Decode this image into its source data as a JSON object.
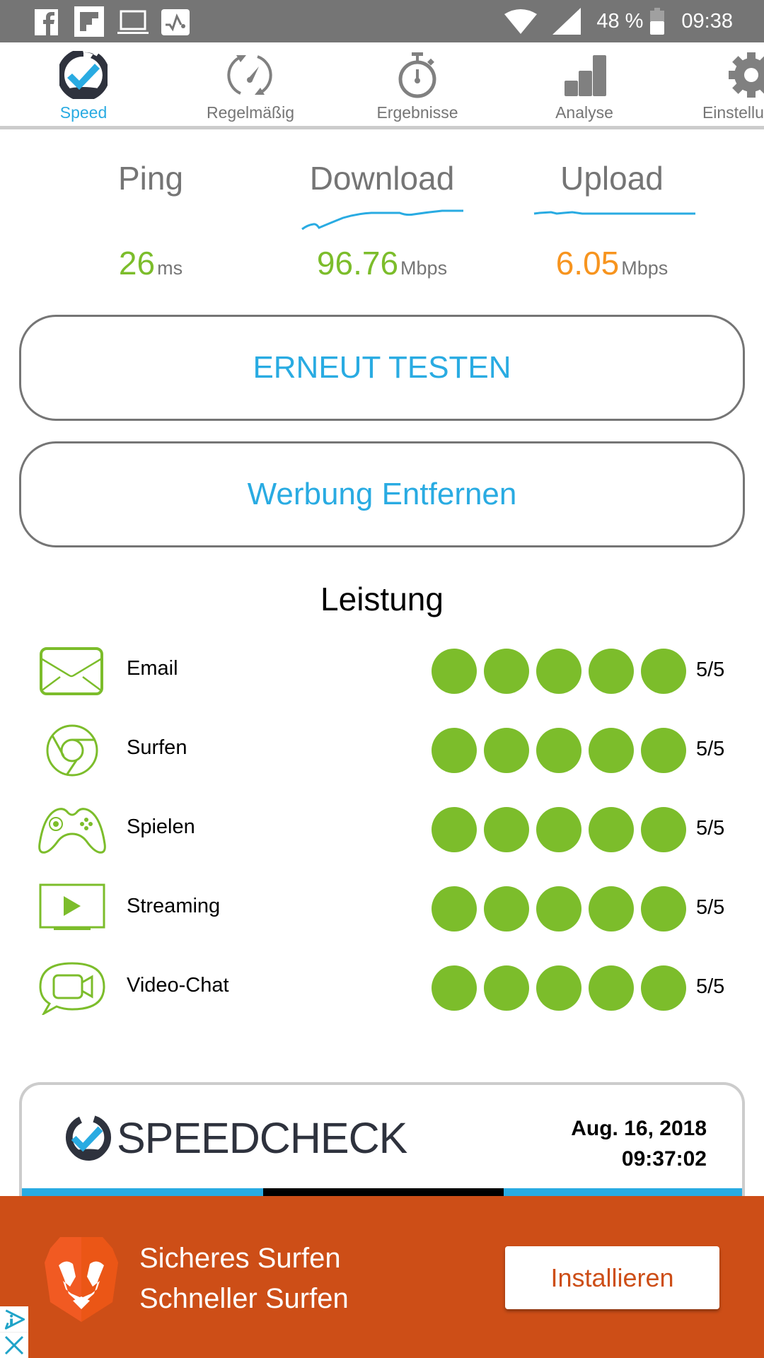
{
  "status_bar": {
    "battery": "48 %",
    "time": "09:38",
    "notification_icons": [
      "facebook-icon",
      "flipboard-icon",
      "laptop-icon",
      "activity-icon"
    ]
  },
  "tabs": [
    {
      "label": "Speed",
      "icon": "speed-check-icon",
      "active": true
    },
    {
      "label": "Regelmäßig",
      "icon": "recurring-gauge-icon",
      "active": false
    },
    {
      "label": "Ergebnisse",
      "icon": "stopwatch-icon",
      "active": false
    },
    {
      "label": "Analyse",
      "icon": "bar-chart-icon",
      "active": false
    },
    {
      "label": "Einstellungen",
      "icon": "gear-icon",
      "active": false
    }
  ],
  "metrics": {
    "ping": {
      "title": "Ping",
      "value": "26",
      "unit": "ms"
    },
    "download": {
      "title": "Download",
      "value": "96.76",
      "unit": "Mbps"
    },
    "upload": {
      "title": "Upload",
      "value": "6.05",
      "unit": "Mbps"
    }
  },
  "buttons": {
    "retest": "ERNEUT TESTEN",
    "remove_ads": "Werbung Entfernen"
  },
  "performance": {
    "title": "Leistung",
    "items": [
      {
        "label": "Email",
        "icon": "email-icon",
        "score": 5,
        "max": 5,
        "score_text": "5/5"
      },
      {
        "label": "Surfen",
        "icon": "browser-icon",
        "score": 5,
        "max": 5,
        "score_text": "5/5"
      },
      {
        "label": "Spielen",
        "icon": "gamepad-icon",
        "score": 5,
        "max": 5,
        "score_text": "5/5"
      },
      {
        "label": "Streaming",
        "icon": "tv-play-icon",
        "score": 5,
        "max": 5,
        "score_text": "5/5"
      },
      {
        "label": "Video-Chat",
        "icon": "video-chat-icon",
        "score": 5,
        "max": 5,
        "score_text": "5/5"
      }
    ]
  },
  "result_card": {
    "brand": "SPEEDCHECK",
    "date": "Aug. 16, 2018",
    "time": "09:37:02"
  },
  "ad": {
    "line1": "Sicheres Surfen",
    "line2": "Schneller Surfen",
    "cta": "Installieren"
  },
  "colors": {
    "accent": "#29abe2",
    "good": "#7cbd2b",
    "upload": "#f7941e",
    "ad_bg": "#cd4e17",
    "status_bar": "#757575"
  }
}
